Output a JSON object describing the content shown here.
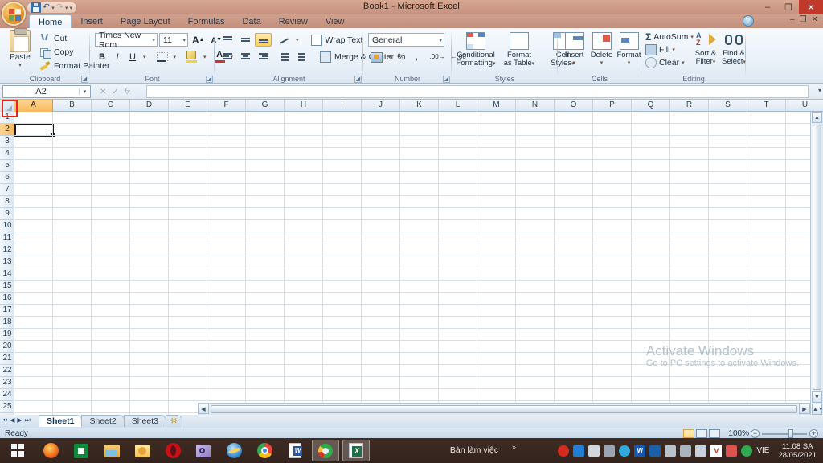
{
  "window": {
    "title": "Book1 - Microsoft Excel",
    "minimize": "–",
    "restore": "❐",
    "close": "✕",
    "help_icon": "?",
    "doc_minimize": "–",
    "doc_restore": "❐",
    "doc_close": "✕"
  },
  "quick_access": {
    "save": "save-icon",
    "undo": "↶",
    "redo": "↷",
    "customize": "▾"
  },
  "tabs": [
    {
      "label": "Home",
      "active": true
    },
    {
      "label": "Insert",
      "active": false
    },
    {
      "label": "Page Layout",
      "active": false
    },
    {
      "label": "Formulas",
      "active": false
    },
    {
      "label": "Data",
      "active": false
    },
    {
      "label": "Review",
      "active": false
    },
    {
      "label": "View",
      "active": false
    }
  ],
  "ribbon": {
    "clipboard": {
      "group_label": "Clipboard",
      "paste": "Paste",
      "paste_caret": "▾",
      "cut": "Cut",
      "copy": "Copy",
      "format_painter": "Format Painter",
      "dialog_launcher": "⤵"
    },
    "font": {
      "group_label": "Font",
      "font_name": "Times New Rom",
      "font_size": "11",
      "grow_font": "A",
      "shrink_font": "A",
      "bold": "B",
      "italic": "I",
      "underline": "U",
      "borders": "borders-icon",
      "fill_color": "fill-color-icon",
      "font_color": "A",
      "caret": "▾",
      "dialog_launcher": "⤵"
    },
    "alignment": {
      "group_label": "Alignment",
      "align_top": "align-top-icon",
      "align_middle": "align-middle-icon",
      "align_bottom": "align-bottom-icon",
      "orientation": "orientation-icon",
      "align_left": "align-left-icon",
      "align_center": "align-center-icon",
      "align_right": "align-right-icon",
      "decrease_indent": "decrease-indent-icon",
      "increase_indent": "increase-indent-icon",
      "wrap_text": "Wrap Text",
      "merge_center": "Merge & Center",
      "caret": "▾",
      "dialog_launcher": "⤵"
    },
    "number": {
      "group_label": "Number",
      "format": "General",
      "format_caret": "▾",
      "accounting": "accounting-icon",
      "percent": "%",
      "comma": ",",
      "increase_decimal": "increase-decimal-icon",
      "decrease_decimal": "decrease-decimal-icon",
      "dialog_launcher": "⤵"
    },
    "styles": {
      "group_label": "Styles",
      "conditional_formatting": "Conditional\nFormatting",
      "conditional_formatting_l1": "Conditional",
      "conditional_formatting_l2": "Formatting",
      "format_as_table_l1": "Format",
      "format_as_table_l2": "as Table",
      "cell_styles_l1": "Cell",
      "cell_styles_l2": "Styles",
      "caret": "▾"
    },
    "cells": {
      "group_label": "Cells",
      "insert": "Insert",
      "delete": "Delete",
      "format": "Format",
      "caret": "▾"
    },
    "editing": {
      "group_label": "Editing",
      "autosum": "AutoSum",
      "fill": "Fill",
      "clear": "Clear",
      "sort_filter_l1": "Sort &",
      "sort_filter_l2": "Filter",
      "find_select_l1": "Find &",
      "find_select_l2": "Select",
      "caret": "▾",
      "sigma": "Σ"
    }
  },
  "formula_bar": {
    "name_box_value": "A2",
    "name_box_caret": "▾",
    "cancel": "✕",
    "enter": "✓",
    "insert_function": "fx",
    "formula_value": "",
    "expand_caret": "▾"
  },
  "sheet": {
    "columns": [
      "A",
      "B",
      "C",
      "D",
      "E",
      "F",
      "G",
      "H",
      "I",
      "J",
      "K",
      "L",
      "M",
      "N",
      "O",
      "P",
      "Q",
      "R",
      "S",
      "T",
      "U"
    ],
    "selected_column": "A",
    "rows": [
      "1",
      "2",
      "3",
      "4",
      "5",
      "6",
      "7",
      "8",
      "9",
      "10",
      "11",
      "12",
      "13",
      "14",
      "15",
      "16",
      "17",
      "18",
      "19",
      "20",
      "21",
      "22",
      "23",
      "24",
      "25"
    ],
    "selected_row": "2",
    "active_cell": "A2",
    "select_all_button": "select-all-corner-button",
    "highlight_color": "#e8241c"
  },
  "watermark": {
    "line1": "Activate Windows",
    "line2": "Go to PC settings to activate Windows."
  },
  "sheet_tabs": {
    "first": "⏮",
    "prev": "◀",
    "next": "▶",
    "last": "⏭",
    "items": [
      {
        "label": "Sheet1",
        "active": true
      },
      {
        "label": "Sheet2",
        "active": false
      },
      {
        "label": "Sheet3",
        "active": false
      }
    ],
    "insert_sheet": "➕"
  },
  "status_bar": {
    "mode": "Ready",
    "view_normal": "normal-view-icon",
    "view_page_layout": "page-layout-view-icon",
    "view_page_break": "page-break-view-icon",
    "zoom_level": "100%",
    "zoom_out": "−",
    "zoom_in": "+"
  },
  "taskbar": {
    "start": "start-button",
    "items": [
      {
        "name": "firefox",
        "active": false
      },
      {
        "name": "microsoft-store",
        "active": false
      },
      {
        "name": "file-explorer",
        "active": false
      },
      {
        "name": "outlook",
        "active": false
      },
      {
        "name": "opera",
        "active": false
      },
      {
        "name": "key-app",
        "active": false
      },
      {
        "name": "internet-explorer",
        "active": false
      },
      {
        "name": "google-chrome",
        "active": false
      },
      {
        "name": "microsoft-word",
        "active": false
      },
      {
        "name": "green-disc-app",
        "active": true
      },
      {
        "name": "microsoft-excel",
        "active": true
      }
    ],
    "desktop_label": "Bàn làm việc",
    "tray_chevron": "»",
    "language": "VIE",
    "time": "11:08 SA",
    "date": "28/05/2021"
  }
}
